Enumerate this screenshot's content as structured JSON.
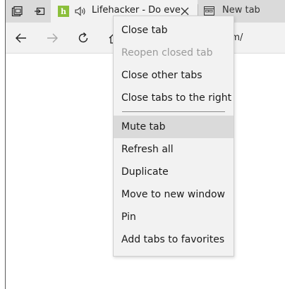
{
  "tabs": {
    "active": {
      "favicon_letter": "h",
      "title": "Lifehacker - Do eve",
      "favicon_color": "#8bbf3b"
    },
    "inactive": {
      "title": "New tab"
    }
  },
  "navbar": {
    "address_text": "r.com/"
  },
  "context_menu": {
    "items": [
      {
        "label": "Close tab"
      },
      {
        "label": "Reopen closed tab",
        "disabled": true
      },
      {
        "label": "Close other tabs"
      },
      {
        "label": "Close tabs to the right"
      },
      {
        "label": "Mute tab",
        "highlighted": true
      },
      {
        "label": "Refresh all"
      },
      {
        "label": "Duplicate"
      },
      {
        "label": "Move to new window"
      },
      {
        "label": "Pin"
      },
      {
        "label": "Add tabs to favorites"
      }
    ]
  },
  "colors": {
    "tabstrip_bg": "#dadada",
    "chrome_bg": "#f2f2f2",
    "menu_highlight": "#dadada",
    "disabled_text": "#9a9a9a"
  }
}
